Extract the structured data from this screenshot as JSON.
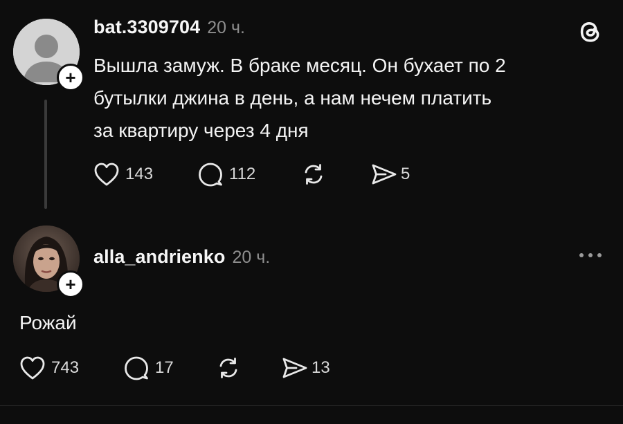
{
  "post": {
    "username": "bat.3309704",
    "time": "20 ч.",
    "text": "Вышла замуж. В браке месяц. Он бухает по 2 бутылки джина в день, а нам нечем платить за квартиру через 4 дня",
    "text_lines": [
      "Вышла замуж. В браке месяц. Он бухает по 2",
      "бутылки джина в день, а нам нечем платить",
      "за квартиру через 4 дня"
    ],
    "likes": "143",
    "replies": "112",
    "shares": "5"
  },
  "reply": {
    "username": "alla_andrienko",
    "time": "20 ч.",
    "text": "Рожай",
    "likes": "743",
    "replies": "17",
    "shares": "13"
  },
  "icons": {
    "app_logo": "threads-logo-icon",
    "more": "more-icon",
    "like": "heart-icon",
    "reply": "comment-icon",
    "repost": "repost-icon",
    "share": "send-icon",
    "follow": "plus-icon"
  },
  "colors": {
    "background": "#0d0d0d",
    "text": "#f3f3f3",
    "muted": "#8e8e8e"
  }
}
